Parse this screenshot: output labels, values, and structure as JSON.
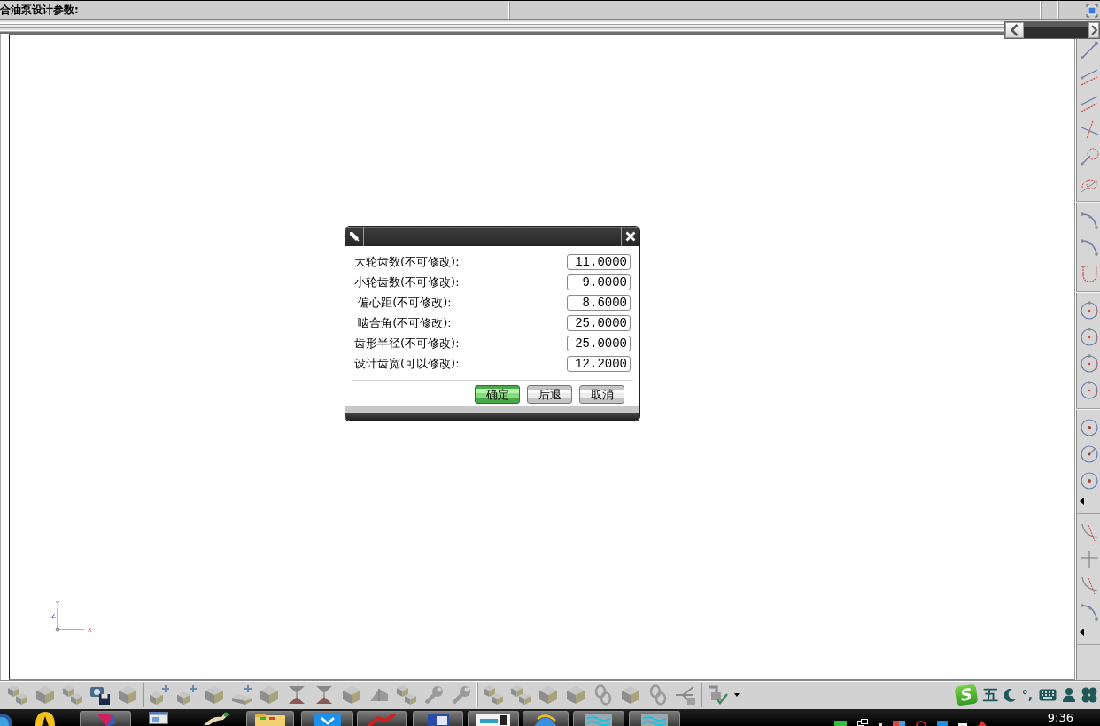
{
  "window": {
    "title": "合油泵设计参数:"
  },
  "axis_triad": {
    "y_label": "Y",
    "z_label": "Z",
    "x_label": "X"
  },
  "dialog": {
    "fields": [
      {
        "label": "大轮齿数(不可修改):",
        "value": "11.0000"
      },
      {
        "label": "小轮齿数(不可修改):",
        "value": "9.0000"
      },
      {
        "label": " 偏心距(不可修改):",
        "value": "8.6000"
      },
      {
        "label": " 啮合角(不可修改):",
        "value": "25.0000"
      },
      {
        "label": "齿形半径(不可修改):",
        "value": "25.0000"
      },
      {
        "label": "设计齿宽(可以修改):",
        "value": "12.2000"
      }
    ],
    "buttons": [
      {
        "label": "确定",
        "default": true
      },
      {
        "label": "后退",
        "default": false
      },
      {
        "label": "取消",
        "default": false
      }
    ]
  },
  "ime_toolbar": {
    "logo": "S",
    "mode": "五",
    "punctuation": "°,"
  },
  "taskbar": {
    "clock": "9:36"
  }
}
